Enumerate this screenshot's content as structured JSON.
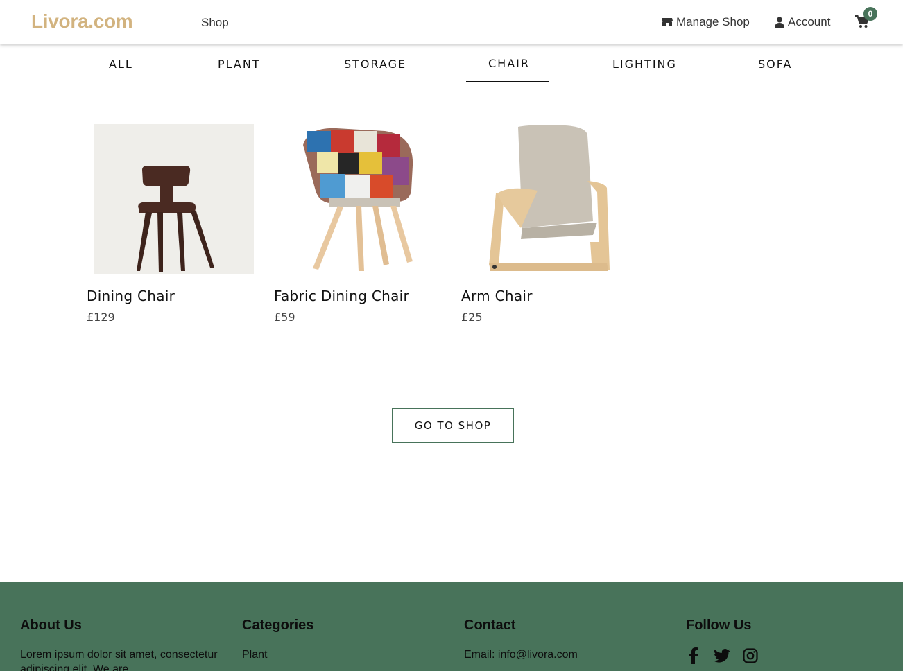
{
  "header": {
    "logo": "Livora.com",
    "nav_shop": "Shop",
    "manage_shop": "Manage Shop",
    "account": "Account",
    "cart_count": "0"
  },
  "tabs": [
    {
      "label": "ALL"
    },
    {
      "label": "PLANT"
    },
    {
      "label": "STORAGE"
    },
    {
      "label": "CHAIR",
      "active": true
    },
    {
      "label": "LIGHTING"
    },
    {
      "label": "SOFA"
    }
  ],
  "products": [
    {
      "name": "Dining Chair",
      "price": "£129"
    },
    {
      "name": "Fabric Dining Chair",
      "price": "£59"
    },
    {
      "name": "Arm Chair",
      "price": "£25"
    }
  ],
  "cta": {
    "go_to_shop": "GO TO SHOP"
  },
  "footer": {
    "about": {
      "heading": "About Us",
      "text": "Lorem ipsum dolor sit amet, consectetur adipiscing elit. We are"
    },
    "categories": {
      "heading": "Categories",
      "items": [
        "Plant"
      ]
    },
    "contact": {
      "heading": "Contact",
      "email": "Email: info@livora.com"
    },
    "follow": {
      "heading": "Follow Us",
      "icons": [
        "facebook-icon",
        "twitter-icon",
        "instagram-icon"
      ]
    }
  },
  "colors": {
    "brand": "#d2b37f",
    "accent": "#48735a"
  }
}
